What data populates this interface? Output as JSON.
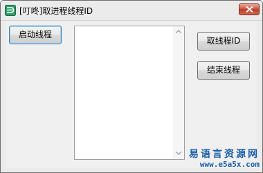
{
  "window": {
    "title": "[叮咚]取进程线程ID",
    "app_icon": "e-language-app-icon",
    "close_icon": "close-x-icon"
  },
  "buttons": {
    "start_thread": "启动线程",
    "get_thread_id": "取线程ID",
    "end_thread": "结束线程"
  },
  "listbox": {
    "items": [],
    "scroll_up_icon": "scroll-up-arrow-icon",
    "scroll_down_icon": "scroll-down-arrow-icon"
  },
  "watermark": {
    "name": "易语言资源网",
    "url": "www.e5a5x.com"
  },
  "colors": {
    "window_bg": "#f0f0f0",
    "close_button": "#c7503c",
    "watermark": "#1a5fa8",
    "focus_border": "#3c7fb1"
  }
}
